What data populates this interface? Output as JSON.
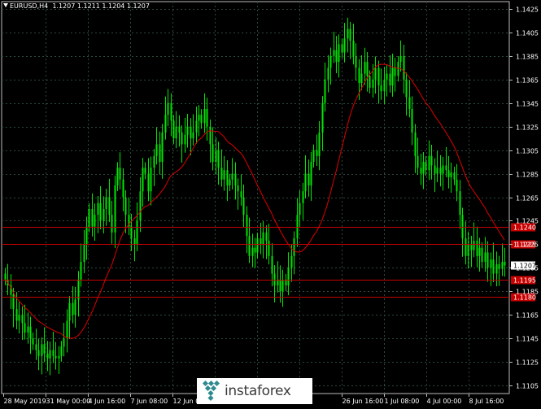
{
  "window": {
    "symbol": "EURUSD,H4",
    "ohlc": "1.1207 1.1211 1.1204 1.1207"
  },
  "colors": {
    "background": "#000000",
    "grid": "#2a4a3a",
    "candle": "#00e600",
    "moving_average": "#e00000",
    "level_line": "#c80000",
    "level_label_bg": "#c80000",
    "price_label_bg": "#ffffff",
    "axis_text": "#ffffff"
  },
  "price_axis": {
    "ticks": [
      "1.1425",
      "1.1405",
      "1.1385",
      "1.1365",
      "1.1345",
      "1.1325",
      "1.1305",
      "1.1285",
      "1.1265",
      "1.1245",
      "1.1225",
      "1.1205",
      "1.1185",
      "1.1165",
      "1.1145",
      "1.1125",
      "1.1105"
    ],
    "current_price": "1.1207"
  },
  "time_axis": {
    "labels": [
      "28 May 2019",
      "31 May 00:00",
      "4 Jun 16:00",
      "7 Jun 08:00",
      "12 Jun 00:00",
      "",
      "",
      "",
      "26 Jun 16:00",
      "1 Jul 08:00",
      "4 Jul 00:00",
      "8 Jul 16:00"
    ]
  },
  "levels": [
    {
      "price": 1.124,
      "label": "1.1240"
    },
    {
      "price": 1.1225,
      "label": "1.1225"
    },
    {
      "price": 1.1195,
      "label": "1.1195"
    },
    {
      "price": 1.118,
      "label": "1.1180"
    }
  ],
  "watermark": {
    "text": "instaforex",
    "logo_icon": "instaforex-logo-icon"
  },
  "chart_data": {
    "type": "candlestick",
    "ylim": [
      1.1105,
      1.1425
    ],
    "closes": [
      1.1195,
      1.119,
      1.1182,
      1.117,
      1.116,
      1.1165,
      1.1158,
      1.115,
      1.1155,
      1.1145,
      1.114,
      1.1135,
      1.113,
      1.114,
      1.1132,
      1.1128,
      1.1135,
      1.113,
      1.1128,
      1.113,
      1.1138,
      1.1145,
      1.116,
      1.1175,
      1.1165,
      1.1178,
      1.1195,
      1.121,
      1.1225,
      1.124,
      1.1255,
      1.124,
      1.125,
      1.126,
      1.1245,
      1.1255,
      1.1265,
      1.125,
      1.1235,
      1.1275,
      1.129,
      1.128,
      1.1265,
      1.125,
      1.124,
      1.123,
      1.1225,
      1.1245,
      1.127,
      1.129,
      1.1285,
      1.127,
      1.129,
      1.13,
      1.131,
      1.1295,
      1.132,
      1.1335,
      1.1345,
      1.133,
      1.1315,
      1.1325,
      1.132,
      1.131,
      1.1318,
      1.1325,
      1.1315,
      1.132,
      1.133,
      1.1335,
      1.1328,
      1.134,
      1.1325,
      1.131,
      1.1295,
      1.1305,
      1.129,
      1.128,
      1.1288,
      1.1275,
      1.128,
      1.1285,
      1.1275,
      1.127,
      1.1265,
      1.125,
      1.1232,
      1.1215,
      1.1222,
      1.1218,
      1.123,
      1.1225,
      1.1235,
      1.1228,
      1.1215,
      1.12,
      1.119,
      1.1195,
      1.1185,
      1.1195,
      1.119,
      1.1205,
      1.1215,
      1.123,
      1.125,
      1.126,
      1.127,
      1.1285,
      1.1275,
      1.1295,
      1.1305,
      1.13,
      1.132,
      1.1345,
      1.1365,
      1.1375,
      1.1385,
      1.139,
      1.138,
      1.1395,
      1.1388,
      1.14,
      1.1408,
      1.1398,
      1.1385,
      1.1375,
      1.1362,
      1.137,
      1.138,
      1.1368,
      1.1358,
      1.1365,
      1.1375,
      1.136,
      1.1355,
      1.1365,
      1.137,
      1.136,
      1.1375,
      1.1368,
      1.138,
      1.1385,
      1.1365,
      1.135,
      1.134,
      1.132,
      1.13,
      1.129,
      1.1285,
      1.1295,
      1.1288,
      1.13,
      1.1292,
      1.1285,
      1.129,
      1.1285,
      1.1292,
      1.1288,
      1.1282,
      1.1286,
      1.128,
      1.127,
      1.125,
      1.123,
      1.1215,
      1.1225,
      1.122,
      1.1228,
      1.1215,
      1.1222,
      1.121,
      1.1218,
      1.1205,
      1.1212,
      1.12,
      1.1208,
      1.1204,
      1.121,
      1.1207
    ],
    "moving_average_period": 21
  }
}
